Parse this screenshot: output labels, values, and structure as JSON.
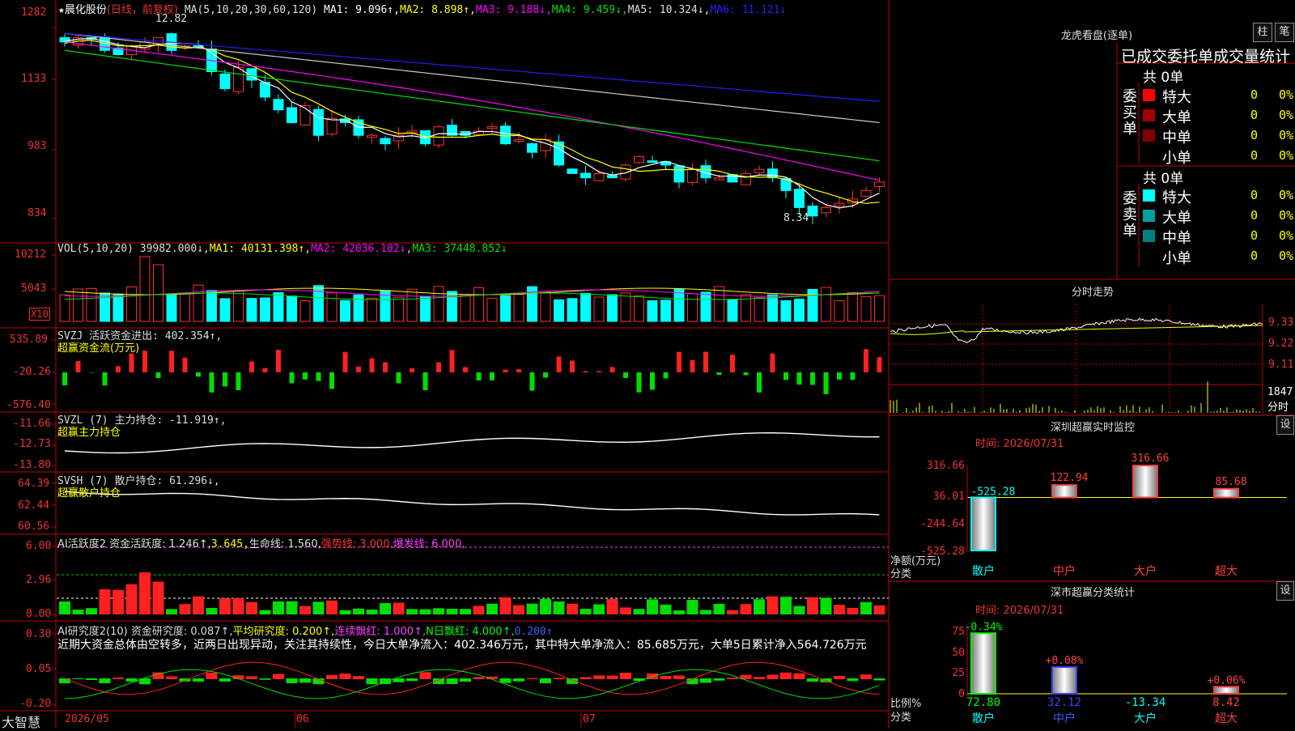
{
  "stock": {
    "star": "★",
    "name": "晨化股份",
    "period": "(日线，前复权)",
    "ma_label": "MA(5,10,20,30,60,120)",
    "ma": [
      {
        "label": "MA1: 9.096↑",
        "color": "#ffffff"
      },
      {
        "label": "MA2: 8.898↑",
        "color": "#ffff00"
      },
      {
        "label": "MA3: 9.188↓",
        "color": "#ff00ff"
      },
      {
        "label": "MA4: 9.459↓",
        "color": "#00e000"
      },
      {
        "label": "MA5: 10.324↓",
        "color": "#dddddd"
      },
      {
        "label": "MA6: 11.121↓",
        "color": "#2020ff"
      }
    ],
    "price_axis": [
      "1282",
      "1133",
      "983",
      "834"
    ],
    "high_mark": "12.82",
    "low_mark": "8.34"
  },
  "vol": {
    "label": "VOL(5,10,20)",
    "value": "39982.000↓",
    "ma1": "MA1: 40131.398↑",
    "ma2": "MA2: 42036.102↓",
    "ma3": "MA3: 37448.852↓",
    "axis": [
      "10212",
      "5043"
    ],
    "unit": "X10"
  },
  "svzj": {
    "label": "SVZJ  活跃资金进出: 402.354↑,",
    "sub": "超赢资金流(万元)",
    "axis": [
      "535.89",
      "-20.26",
      "-576.40"
    ]
  },
  "svzl": {
    "label": "SVZL (7) 主力持仓: -11.919↑,",
    "sub": "超赢主力持仓",
    "axis": [
      "-11.66",
      "-12.73",
      "-13.80"
    ]
  },
  "svsh": {
    "label": "SVSH (7) 散户持仓: 61.296↓,",
    "sub": "超赢散户持仓",
    "axis": [
      "64.39",
      "62.44",
      "60.56"
    ]
  },
  "ai1": {
    "label": "AI活跃度2 资金活跃度: 1.246↑,",
    "v2": "3.645,",
    "life": "生命线: 1.560,",
    "strong": "强势线: 3.000,",
    "burst": "爆发线: 6.000,",
    "axis": [
      "6.00",
      "2.96",
      "0.00"
    ]
  },
  "ai2": {
    "label": "AI研究度2(10) 资金研究度: 0.087↑,",
    "avg": "平均研究度: 0.200↑,",
    "cont": "连续飘红: 1.000↑,",
    "nday": "N日飘红: 4.000↑,",
    "last": "0.200↑",
    "text": "近期大资金总体由空转多，近两日出现异动，关注其持续性，今日大单净流入：402.346万元，其中特大单净流入：85.685万元，大单5日累计净入564.726万元",
    "axis": [
      "0.30",
      "0.05",
      "-0.20"
    ]
  },
  "footer": {
    "brand": "大智慧",
    "dates": [
      "2026/05",
      "06",
      "07"
    ]
  },
  "longhu": {
    "title": "龙虎看盘(逐单)",
    "btn1": "柱",
    "btn2": "笔",
    "subtitle": "已成交委托单成交量统计",
    "buy_label": "委买单",
    "sell_label": "委卖单",
    "buy_total": "共 0单",
    "sell_total": "共 0单",
    "buy_rows": [
      {
        "name": "特大",
        "v": "0",
        "p": "0%",
        "color": "#ff0000"
      },
      {
        "name": "大单",
        "v": "0",
        "p": "0%",
        "color": "#a00000"
      },
      {
        "name": "中单",
        "v": "0",
        "p": "0%",
        "color": "#800000"
      },
      {
        "name": "小单",
        "v": "0",
        "p": "0%",
        "color": ""
      }
    ],
    "sell_rows": [
      {
        "name": "特大",
        "v": "0",
        "p": "0%",
        "color": "#00ffff"
      },
      {
        "name": "大单",
        "v": "0",
        "p": "0%",
        "color": "#00a0a0"
      },
      {
        "name": "中单",
        "v": "0",
        "p": "0%",
        "color": "#008080"
      },
      {
        "name": "小单",
        "v": "0",
        "p": "0%",
        "color": ""
      }
    ]
  },
  "fenshi": {
    "title": "分时走势",
    "axis": [
      "9.33",
      "9.22",
      "9.11"
    ],
    "vol_axis": "1847",
    "vol_unit": "分时"
  },
  "monitor": {
    "title": "深圳超赢实时监控",
    "btn": "设",
    "time": "时间: 2026/07/31",
    "axis": [
      "316.66",
      "36.01",
      "-244.64",
      "-525.28"
    ],
    "y_unit": "净额(万元)",
    "x_unit": "分类",
    "bars": [
      {
        "cat": "散户",
        "value": -525.28,
        "label": "-525.28",
        "color": "#00ffff"
      },
      {
        "cat": "中户",
        "value": 122.94,
        "label": "122.94",
        "color": "#ff4040"
      },
      {
        "cat": "大户",
        "value": 316.66,
        "label": "316.66",
        "color": "#ff4040"
      },
      {
        "cat": "超大",
        "value": 85.68,
        "label": "85.68",
        "color": "#ff4040"
      }
    ]
  },
  "classify": {
    "title": "深市超赢分类统计",
    "btn": "设",
    "time": "时间: 2026/07/31",
    "axis": [
      "75",
      "50",
      "25",
      "0"
    ],
    "y_unit": "比例%",
    "x_unit": "分类",
    "bars": [
      {
        "cat": "散户",
        "value": 72.8,
        "label": "72.80",
        "delta": "-0.34%",
        "color": "#00ff00"
      },
      {
        "cat": "中户",
        "value": 32.12,
        "label": "32.12",
        "delta": "+0.08%",
        "color": "#4040ff"
      },
      {
        "cat": "大户",
        "value": -13.34,
        "label": "-13.34",
        "delta": "",
        "color": "#00ffff"
      },
      {
        "cat": "超大",
        "value": 8.42,
        "label": "8.42",
        "delta": "+0.06%",
        "color": "#ff4040"
      }
    ]
  }
}
